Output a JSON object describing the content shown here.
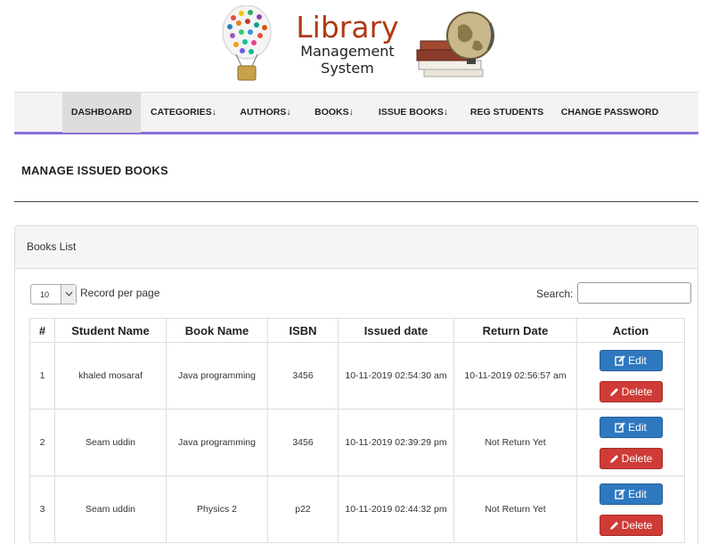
{
  "logo": {
    "title": "Library",
    "subtitle_line1": "Management",
    "subtitle_line2": "System"
  },
  "nav": {
    "items": [
      {
        "label": "DASHBOARD",
        "arrow": ""
      },
      {
        "label": "CATEGORIES",
        "arrow": "↓"
      },
      {
        "label": "AUTHORS",
        "arrow": "↓"
      },
      {
        "label": "BOOKS",
        "arrow": "↓"
      },
      {
        "label": "ISSUE BOOKS",
        "arrow": "↓"
      },
      {
        "label": "REG STUDENTS",
        "arrow": ""
      },
      {
        "label": "CHANGE PASSWORD",
        "arrow": ""
      }
    ],
    "active": "DASHBOARD",
    "accent": "#8c6fd9"
  },
  "page": {
    "title": "MANAGE ISSUED BOOKS"
  },
  "panel": {
    "heading": "Books List",
    "length_value": "10",
    "length_label": "Record per page",
    "search_label": "Search:",
    "search_value": ""
  },
  "table": {
    "headers": [
      "#",
      "Student Name",
      "Book Name",
      "ISBN",
      "Issued date",
      "Return Date",
      "Action"
    ],
    "rows": [
      {
        "num": "1",
        "student": "khaled mosaraf",
        "book": "Java programming",
        "isbn": "3456",
        "issued": "10-11-2019 02:54:30 am",
        "returned": "10-11-2019 02:56:57 am"
      },
      {
        "num": "2",
        "student": "Seam uddin",
        "book": "Java programming",
        "isbn": "3456",
        "issued": "10-11-2019 02:39:29 pm",
        "returned": "Not Return Yet"
      },
      {
        "num": "3",
        "student": "Seam uddin",
        "book": "Physics 2",
        "isbn": "p22",
        "issued": "10-11-2019 02:44:32 pm",
        "returned": "Not Return Yet"
      }
    ],
    "edit_label": "Edit",
    "delete_label": "Delete"
  },
  "colors": {
    "edit_button": "#2e78c0",
    "delete_button": "#cf3b36",
    "logo_title": "#b03a12"
  }
}
